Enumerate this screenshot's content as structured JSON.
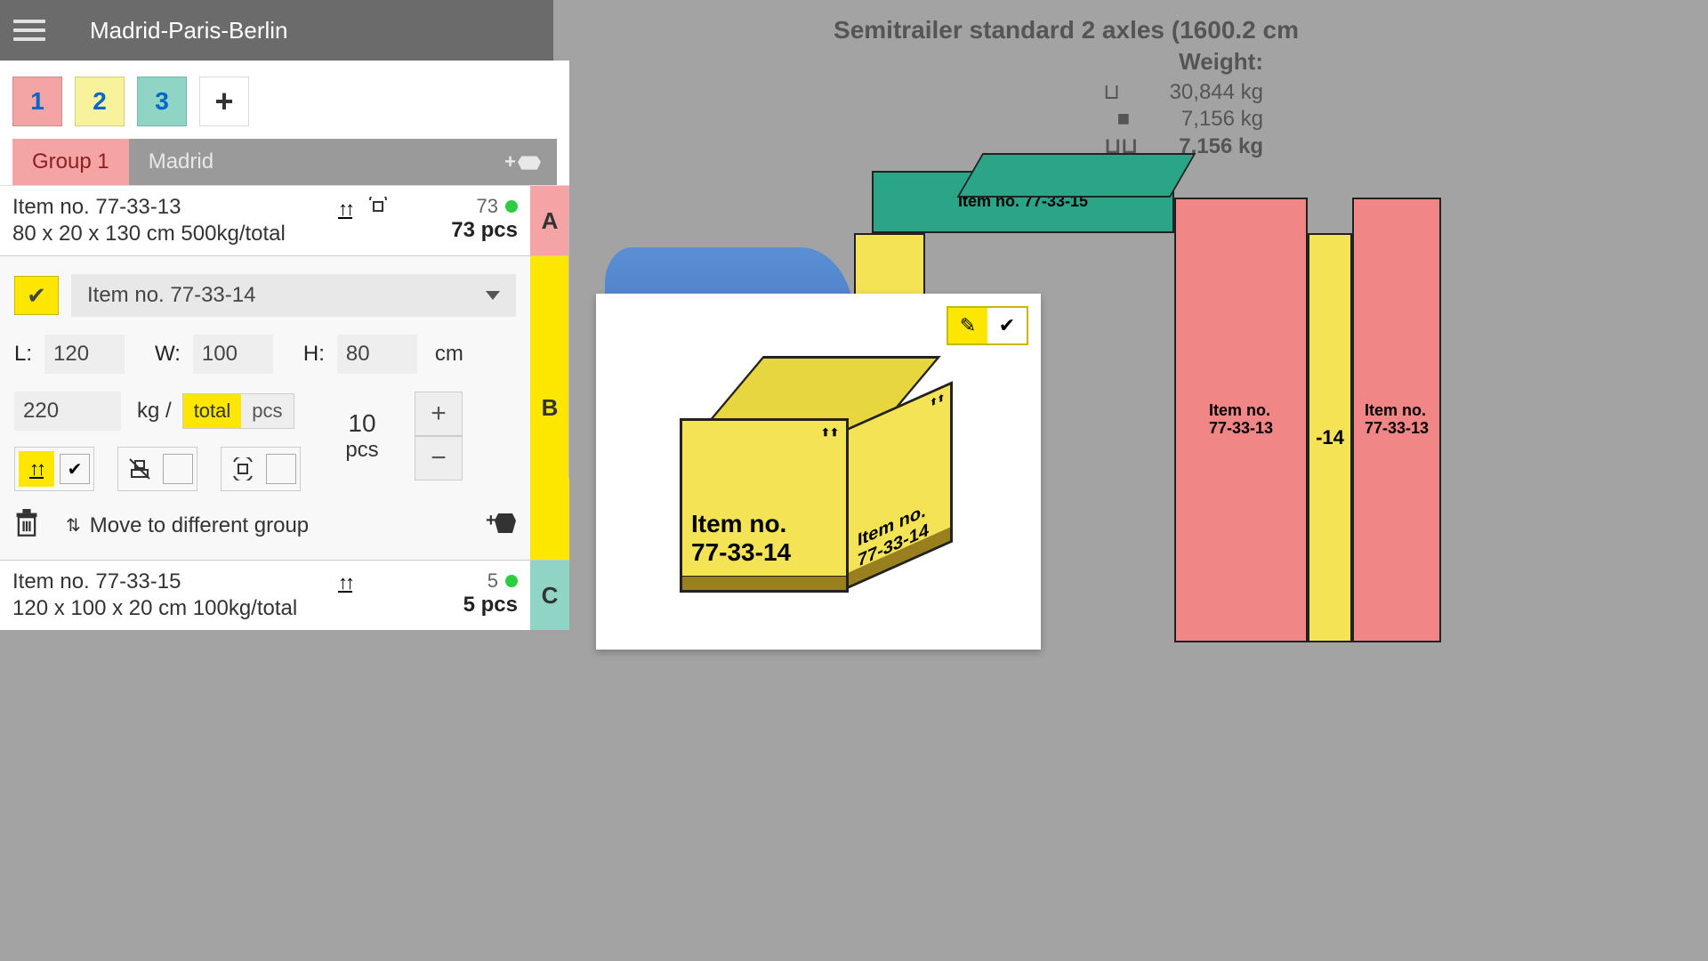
{
  "header": {
    "route": "Madrid-Paris-Berlin"
  },
  "chips": [
    "1",
    "2",
    "3"
  ],
  "tabs": {
    "active": "Group 1",
    "inactive": "Madrid"
  },
  "items": {
    "a": {
      "name": "Item no. 77-33-13",
      "dims": "80 x 20 x 130 cm 500kg/total",
      "count": "73",
      "pcs": "73 pcs",
      "letter": "A"
    },
    "b": {
      "name": "Item no. 77-33-14",
      "L": "120",
      "W": "100",
      "H": "80",
      "unit": "cm",
      "weight": "220",
      "weight_unit": "kg /",
      "mode_total": "total",
      "mode_pcs": "pcs",
      "qty": "10",
      "qty_lbl": "pcs",
      "move_label": "Move to different group",
      "letter": "B",
      "labels": {
        "L": "L:",
        "W": "W:",
        "H": "H:"
      }
    },
    "c": {
      "name": "Item no. 77-33-15",
      "dims": "120 x 100 x 20 cm 100kg/total",
      "count": "5",
      "pcs": "5 pcs",
      "letter": "C"
    }
  },
  "vehicle": {
    "title": "Semitrailer standard 2 axles (1600.2 cm",
    "weight_label": "Weight:",
    "rows": [
      {
        "icon": "axle",
        "value": "30,844 kg"
      },
      {
        "icon": "load",
        "value": "7,156 kg"
      },
      {
        "icon": "pallet",
        "value": "7,156 kg"
      }
    ]
  },
  "preview": {
    "label1": "Item no.",
    "label2": "77-33-14",
    "side1": "Item no.",
    "side2": "77-33-14"
  },
  "scene_labels": {
    "green": "Item no. 77-33-15",
    "yellow": "-14",
    "red1": "Item no.",
    "red2": "77-33-13"
  }
}
